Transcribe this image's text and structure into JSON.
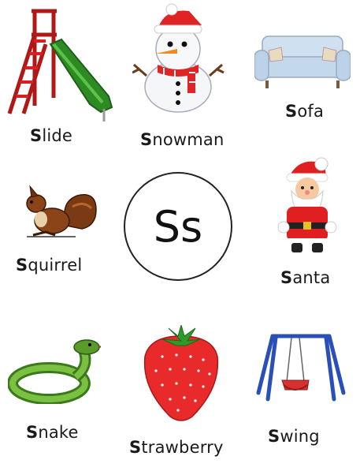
{
  "center_letters": "Ss",
  "items": [
    {
      "first": "S",
      "rest": "lide",
      "icon": "slide-icon"
    },
    {
      "first": "S",
      "rest": "nowman",
      "icon": "snowman-icon"
    },
    {
      "first": "S",
      "rest": "ofa",
      "icon": "sofa-icon"
    },
    {
      "first": "S",
      "rest": "quirrel",
      "icon": "squirrel-icon"
    },
    {
      "first": "S",
      "rest": "anta",
      "icon": "santa-icon"
    },
    {
      "first": "S",
      "rest": "nake",
      "icon": "snake-icon"
    },
    {
      "first": "S",
      "rest": "trawberry",
      "icon": "strawberry-icon"
    },
    {
      "first": "S",
      "rest": "wing",
      "icon": "swing-icon"
    }
  ]
}
